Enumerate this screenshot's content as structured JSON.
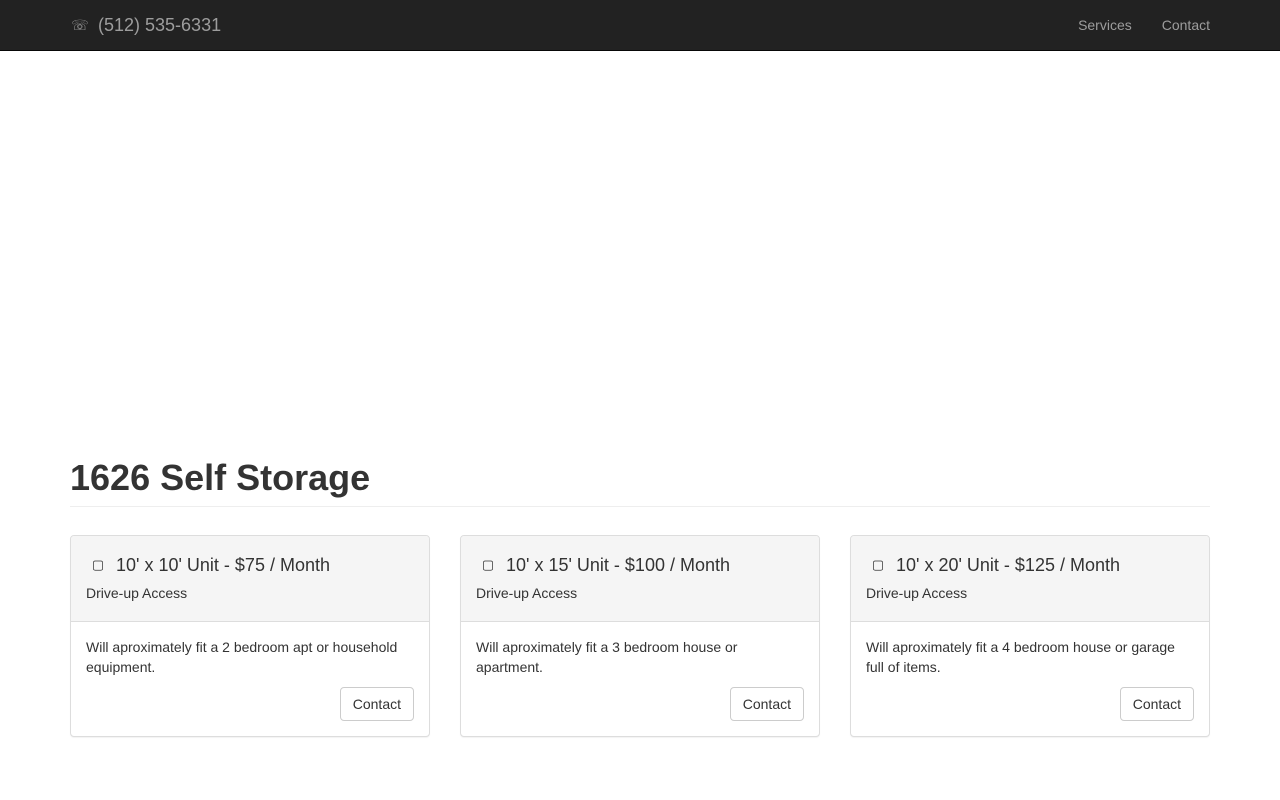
{
  "navbar": {
    "phone_icon": "phone-icon",
    "phone": "(512) 535-6331",
    "links": [
      {
        "label": "Services"
      },
      {
        "label": "Contact"
      }
    ]
  },
  "header": {
    "title": "1626 Self Storage"
  },
  "units": [
    {
      "icon": "box-icon",
      "title": "10' x 10' Unit - $75 / Month",
      "subtitle": "Drive-up Access",
      "description": "Will aproximately fit a 2 bedroom apt or household equipment.",
      "button_label": "Contact"
    },
    {
      "icon": "box-icon",
      "title": "10' x 15' Unit - $100 / Month",
      "subtitle": "Drive-up Access",
      "description": "Will aproximately fit a 3 bedroom house or apartment.",
      "button_label": "Contact"
    },
    {
      "icon": "box-icon",
      "title": "10' x 20' Unit - $125 / Month",
      "subtitle": "Drive-up Access",
      "description": "Will aproximately fit a 4 bedroom house or garage full of items.",
      "button_label": "Contact"
    }
  ],
  "colors": {
    "navbar_bg": "#222222",
    "navbar_text": "#9d9d9d",
    "panel_heading_bg": "#f5f5f5"
  }
}
